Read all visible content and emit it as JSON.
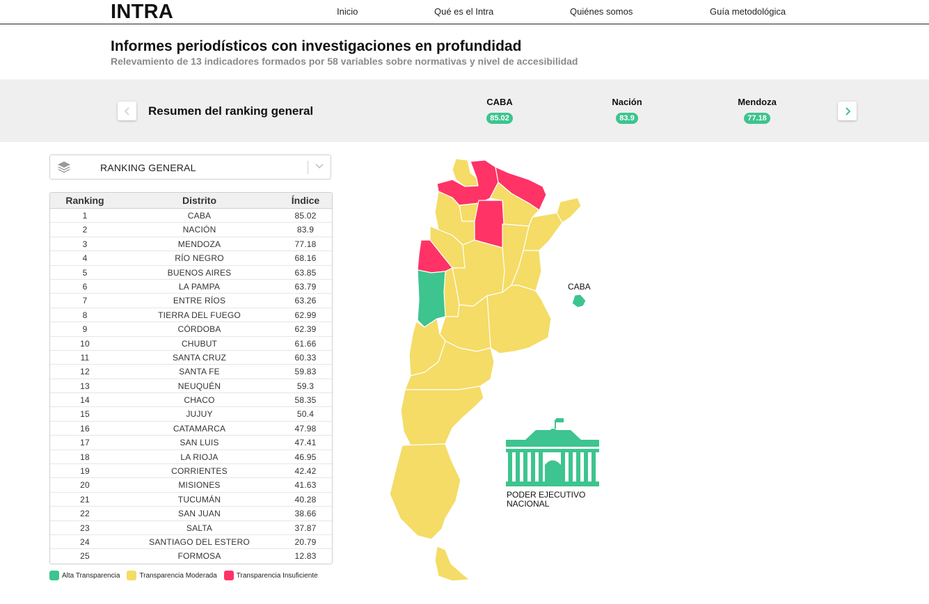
{
  "header": {
    "logo": "INTRA",
    "nav": [
      "Inicio",
      "Qué es el Intra",
      "Quiénes somos",
      "Guía metodológica"
    ]
  },
  "intro": {
    "title": "Informes periodísticos con investigaciones en profundidad",
    "subtitle": "Relevamiento de 13 indicadores formados por 58 variables sobre normativas y nivel de accesibilidad"
  },
  "summary": {
    "title": "Resumen del ranking general",
    "items": [
      {
        "name": "CABA",
        "value": "85.02"
      },
      {
        "name": "Nación",
        "value": "83.9"
      },
      {
        "name": "Mendoza",
        "value": "77.18"
      }
    ]
  },
  "select": {
    "value": "RANKING GENERAL"
  },
  "table": {
    "headers": [
      "Ranking",
      "Distrito",
      "Índice"
    ],
    "rows": [
      [
        "1",
        "CABA",
        "85.02"
      ],
      [
        "2",
        "NACIÓN",
        "83.9"
      ],
      [
        "3",
        "MENDOZA",
        "77.18"
      ],
      [
        "4",
        "RÍO NEGRO",
        "68.16"
      ],
      [
        "5",
        "BUENOS AIRES",
        "63.85"
      ],
      [
        "6",
        "LA PAMPA",
        "63.79"
      ],
      [
        "7",
        "ENTRE RÍOS",
        "63.26"
      ],
      [
        "8",
        "TIERRA DEL FUEGO",
        "62.99"
      ],
      [
        "9",
        "CÓRDOBA",
        "62.39"
      ],
      [
        "10",
        "CHUBUT",
        "61.66"
      ],
      [
        "11",
        "SANTA CRUZ",
        "60.33"
      ],
      [
        "12",
        "SANTA FE",
        "59.83"
      ],
      [
        "13",
        "NEUQUÉN",
        "59.3"
      ],
      [
        "14",
        "CHACO",
        "58.35"
      ],
      [
        "15",
        "JUJUY",
        "50.4"
      ],
      [
        "16",
        "CATAMARCA",
        "47.98"
      ],
      [
        "17",
        "SAN LUIS",
        "47.41"
      ],
      [
        "18",
        "LA RIOJA",
        "46.95"
      ],
      [
        "19",
        "CORRIENTES",
        "42.42"
      ],
      [
        "20",
        "MISIONES",
        "41.63"
      ],
      [
        "21",
        "TUCUMÁN",
        "40.28"
      ],
      [
        "22",
        "SAN JUAN",
        "38.66"
      ],
      [
        "23",
        "SALTA",
        "37.87"
      ],
      [
        "24",
        "SANTIAGO DEL ESTERO",
        "20.79"
      ],
      [
        "25",
        "FORMOSA",
        "12.83"
      ]
    ]
  },
  "legend": [
    {
      "label": "Alta Transparencia",
      "color": "#3dc48f"
    },
    {
      "label": "Transparencia Moderada",
      "color": "#f4dc66"
    },
    {
      "label": "Transparencia Insuficiente",
      "color": "#ff3366"
    }
  ],
  "map": {
    "caba_label": "CABA",
    "pen_label_1": "PODER EJECUTIVO",
    "pen_label_2": "NACIONAL"
  },
  "colors": {
    "high": "#3dc48f",
    "moderate": "#f4dc66",
    "low": "#ff3366"
  }
}
